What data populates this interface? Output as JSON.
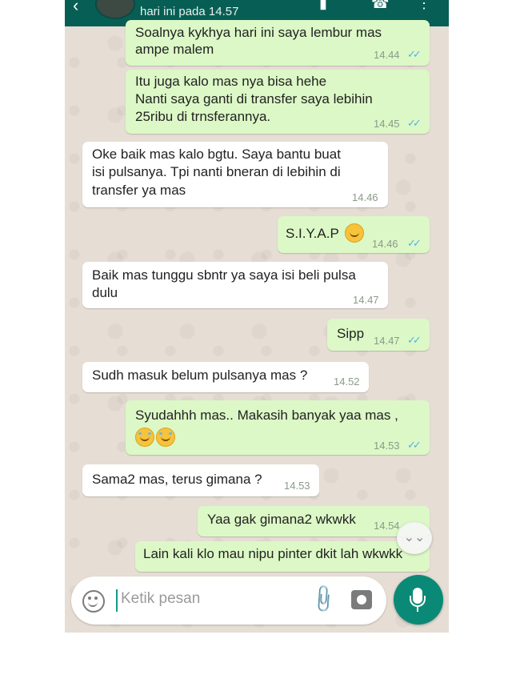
{
  "header": {
    "last_seen": "hari ini pada 14.57"
  },
  "messages": [
    {
      "dir": "out",
      "lines": [
        "Soalnya kykhya hari ini saya lembur mas",
        "ampe malem"
      ],
      "time": "14.44",
      "ticks": "read"
    },
    {
      "dir": "out",
      "lines": [
        "Itu juga kalo mas nya bisa hehe",
        "Nanti saya ganti di transfer saya lebihin",
        "25ribu di trnsferannya."
      ],
      "time": "14.45",
      "ticks": "read"
    },
    {
      "dir": "in",
      "lines": [
        "Oke baik mas kalo bgtu. Saya bantu buat",
        "isi pulsanya. Tpi nanti bneran di lebihin di",
        "transfer ya mas"
      ],
      "time": "14.46"
    },
    {
      "dir": "out",
      "lines": [
        "S.I.Y.A.P"
      ],
      "emoji": "smile",
      "time": "14.46",
      "ticks": "read"
    },
    {
      "dir": "in",
      "lines": [
        "Baik mas tunggu sbntr ya saya isi beli pulsa",
        "dulu"
      ],
      "time": "14.47"
    },
    {
      "dir": "out",
      "lines": [
        "Sipp"
      ],
      "time": "14.47",
      "ticks": "read"
    },
    {
      "dir": "in",
      "lines": [
        "Sudh masuk belum pulsanya mas ?"
      ],
      "time": "14.52"
    },
    {
      "dir": "out",
      "lines": [
        "Syudahhh mas.. Makasih banyak yaa mas ,"
      ],
      "emoji": "laugh-x2",
      "time": "14.53",
      "ticks": "read"
    },
    {
      "dir": "in",
      "lines": [
        "Sama2 mas, terus gimana ?"
      ],
      "time": "14.53"
    },
    {
      "dir": "out",
      "lines": [
        "Yaa gak gimana2 wkwkk"
      ],
      "time": "14.54",
      "ticks": "read"
    },
    {
      "dir": "out",
      "lines": [
        "Lain kali klo mau nipu pinter dkit lah wkwkk"
      ]
    }
  ],
  "composer": {
    "placeholder": "Ketik pesan"
  },
  "colors": {
    "header": "#075e54",
    "outgoing_bubble": "#dcf8c6",
    "incoming_bubble": "#ffffff",
    "read_ticks": "#4fb3e8",
    "mic_button": "#0a8a76"
  },
  "icons": [
    "back-arrow-icon",
    "video-call-icon",
    "phone-call-icon",
    "menu-icon",
    "smiley-icon",
    "attach-icon",
    "camera-icon",
    "mic-icon",
    "scroll-down-icon"
  ]
}
